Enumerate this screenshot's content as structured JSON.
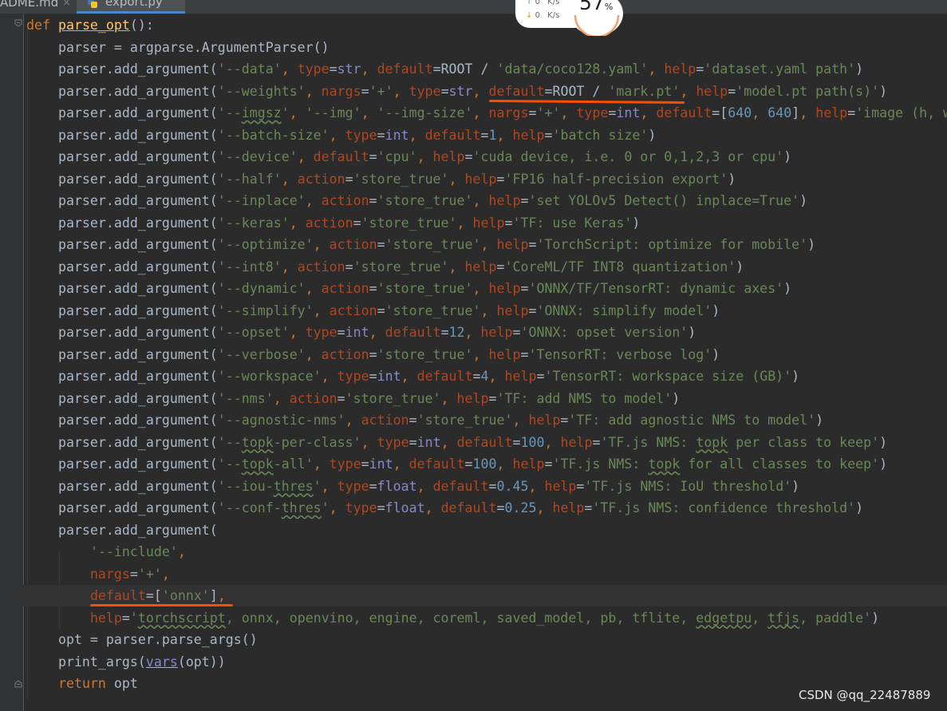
{
  "tabs": [
    {
      "label": "ADME.md",
      "close": "×"
    },
    {
      "label": "export.py"
    }
  ],
  "net_monitor": {
    "upload": "0",
    "download": "0",
    "unit": "K/s",
    "percent": "57",
    "percent_symbol": "%"
  },
  "watermark": "CSDN @qq_22487889",
  "colors": {
    "keyword": "#cc7832",
    "string": "#6a8759",
    "number": "#6897bb",
    "function": "#ffc66d",
    "param": "#aa4926",
    "annotation": "#ff4d00"
  },
  "code": [
    [
      [
        "kw",
        "def "
      ],
      [
        "fn",
        "parse_opt"
      ],
      [
        "tx",
        "():"
      ]
    ],
    [
      [
        "tx",
        "    parser = argparse.ArgumentParser()"
      ]
    ],
    [
      [
        "tx",
        "    parser.add_argument("
      ],
      [
        "str",
        "'--data'"
      ],
      [
        "kw",
        ", "
      ],
      [
        "pn",
        "type"
      ],
      [
        "tx",
        "="
      ],
      [
        "bi",
        "str"
      ],
      [
        "kw",
        ", "
      ],
      [
        "pn",
        "default"
      ],
      [
        "tx",
        "=ROOT / "
      ],
      [
        "str",
        "'data/coco128.yaml'"
      ],
      [
        "kw",
        ", "
      ],
      [
        "pn",
        "help"
      ],
      [
        "tx",
        "="
      ],
      [
        "str",
        "'dataset.yaml path'"
      ],
      [
        "tx",
        ")"
      ]
    ],
    [
      [
        "tx",
        "    parser.add_argument("
      ],
      [
        "str",
        "'--weights'"
      ],
      [
        "kw",
        ", "
      ],
      [
        "pn",
        "nargs"
      ],
      [
        "tx",
        "="
      ],
      [
        "str",
        "'+'"
      ],
      [
        "kw",
        ", "
      ],
      [
        "pn",
        "type"
      ],
      [
        "tx",
        "="
      ],
      [
        "bi",
        "str"
      ],
      [
        "kw",
        ", "
      ],
      [
        "pn",
        "default"
      ],
      [
        "tx",
        "=ROOT / "
      ],
      [
        "str",
        "'mark.pt'"
      ],
      [
        "kw",
        ", "
      ],
      [
        "pn",
        "help"
      ],
      [
        "tx",
        "="
      ],
      [
        "str",
        "'model.pt path(s)'"
      ],
      [
        "tx",
        ")"
      ]
    ],
    [
      [
        "tx",
        "    parser.add_argument("
      ],
      [
        "str",
        "'--"
      ],
      [
        "strw",
        "imgsz"
      ],
      [
        "str",
        "'"
      ],
      [
        "kw",
        ", "
      ],
      [
        "str",
        "'--img'"
      ],
      [
        "kw",
        ", "
      ],
      [
        "str",
        "'--img-size'"
      ],
      [
        "kw",
        ", "
      ],
      [
        "pn",
        "nargs"
      ],
      [
        "tx",
        "="
      ],
      [
        "str",
        "'+'"
      ],
      [
        "kw",
        ", "
      ],
      [
        "pn",
        "type"
      ],
      [
        "tx",
        "="
      ],
      [
        "bi",
        "int"
      ],
      [
        "kw",
        ", "
      ],
      [
        "pn",
        "default"
      ],
      [
        "tx",
        "=["
      ],
      [
        "num",
        "640"
      ],
      [
        "kw",
        ", "
      ],
      [
        "num",
        "640"
      ],
      [
        "tx",
        "]"
      ],
      [
        "kw",
        ", "
      ],
      [
        "pn",
        "help"
      ],
      [
        "tx",
        "="
      ],
      [
        "str",
        "'image (h, w)'"
      ],
      [
        "tx",
        ")"
      ]
    ],
    [
      [
        "tx",
        "    parser.add_argument("
      ],
      [
        "str",
        "'--batch-size'"
      ],
      [
        "kw",
        ", "
      ],
      [
        "pn",
        "type"
      ],
      [
        "tx",
        "="
      ],
      [
        "bi",
        "int"
      ],
      [
        "kw",
        ", "
      ],
      [
        "pn",
        "default"
      ],
      [
        "tx",
        "="
      ],
      [
        "num",
        "1"
      ],
      [
        "kw",
        ", "
      ],
      [
        "pn",
        "help"
      ],
      [
        "tx",
        "="
      ],
      [
        "str",
        "'batch size'"
      ],
      [
        "tx",
        ")"
      ]
    ],
    [
      [
        "tx",
        "    parser.add_argument("
      ],
      [
        "str",
        "'--device'"
      ],
      [
        "kw",
        ", "
      ],
      [
        "pn",
        "default"
      ],
      [
        "tx",
        "="
      ],
      [
        "str",
        "'cpu'"
      ],
      [
        "kw",
        ", "
      ],
      [
        "pn",
        "help"
      ],
      [
        "tx",
        "="
      ],
      [
        "str",
        "'cuda device, i.e. 0 or 0,1,2,3 or cpu'"
      ],
      [
        "tx",
        ")"
      ]
    ],
    [
      [
        "tx",
        "    parser.add_argument("
      ],
      [
        "str",
        "'--half'"
      ],
      [
        "kw",
        ", "
      ],
      [
        "pn",
        "action"
      ],
      [
        "tx",
        "="
      ],
      [
        "str",
        "'store_true'"
      ],
      [
        "kw",
        ", "
      ],
      [
        "pn",
        "help"
      ],
      [
        "tx",
        "="
      ],
      [
        "str",
        "'FP16 half-precision export'"
      ],
      [
        "tx",
        ")"
      ]
    ],
    [
      [
        "tx",
        "    parser.add_argument("
      ],
      [
        "str",
        "'--inplace'"
      ],
      [
        "kw",
        ", "
      ],
      [
        "pn",
        "action"
      ],
      [
        "tx",
        "="
      ],
      [
        "str",
        "'store_true'"
      ],
      [
        "kw",
        ", "
      ],
      [
        "pn",
        "help"
      ],
      [
        "tx",
        "="
      ],
      [
        "str",
        "'set YOLOv5 Detect() inplace=True'"
      ],
      [
        "tx",
        ")"
      ]
    ],
    [
      [
        "tx",
        "    parser.add_argument("
      ],
      [
        "str",
        "'--keras'"
      ],
      [
        "kw",
        ", "
      ],
      [
        "pn",
        "action"
      ],
      [
        "tx",
        "="
      ],
      [
        "str",
        "'store_true'"
      ],
      [
        "kw",
        ", "
      ],
      [
        "pn",
        "help"
      ],
      [
        "tx",
        "="
      ],
      [
        "str",
        "'TF: use Keras'"
      ],
      [
        "tx",
        ")"
      ]
    ],
    [
      [
        "tx",
        "    parser.add_argument("
      ],
      [
        "str",
        "'--optimize'"
      ],
      [
        "kw",
        ", "
      ],
      [
        "pn",
        "action"
      ],
      [
        "tx",
        "="
      ],
      [
        "str",
        "'store_true'"
      ],
      [
        "kw",
        ", "
      ],
      [
        "pn",
        "help"
      ],
      [
        "tx",
        "="
      ],
      [
        "str",
        "'TorchScript: optimize for mobile'"
      ],
      [
        "tx",
        ")"
      ]
    ],
    [
      [
        "tx",
        "    parser.add_argument("
      ],
      [
        "str",
        "'--int8'"
      ],
      [
        "kw",
        ", "
      ],
      [
        "pn",
        "action"
      ],
      [
        "tx",
        "="
      ],
      [
        "str",
        "'store_true'"
      ],
      [
        "kw",
        ", "
      ],
      [
        "pn",
        "help"
      ],
      [
        "tx",
        "="
      ],
      [
        "str",
        "'CoreML/TF INT8 quantization'"
      ],
      [
        "tx",
        ")"
      ]
    ],
    [
      [
        "tx",
        "    parser.add_argument("
      ],
      [
        "str",
        "'--dynamic'"
      ],
      [
        "kw",
        ", "
      ],
      [
        "pn",
        "action"
      ],
      [
        "tx",
        "="
      ],
      [
        "str",
        "'store_true'"
      ],
      [
        "kw",
        ", "
      ],
      [
        "pn",
        "help"
      ],
      [
        "tx",
        "="
      ],
      [
        "str",
        "'ONNX/TF/TensorRT: dynamic axes'"
      ],
      [
        "tx",
        ")"
      ]
    ],
    [
      [
        "tx",
        "    parser.add_argument("
      ],
      [
        "str",
        "'--simplify'"
      ],
      [
        "kw",
        ", "
      ],
      [
        "pn",
        "action"
      ],
      [
        "tx",
        "="
      ],
      [
        "str",
        "'store_true'"
      ],
      [
        "kw",
        ", "
      ],
      [
        "pn",
        "help"
      ],
      [
        "tx",
        "="
      ],
      [
        "str",
        "'ONNX: simplify model'"
      ],
      [
        "tx",
        ")"
      ]
    ],
    [
      [
        "tx",
        "    parser.add_argument("
      ],
      [
        "str",
        "'--opset'"
      ],
      [
        "kw",
        ", "
      ],
      [
        "pn",
        "type"
      ],
      [
        "tx",
        "="
      ],
      [
        "bi",
        "int"
      ],
      [
        "kw",
        ", "
      ],
      [
        "pn",
        "default"
      ],
      [
        "tx",
        "="
      ],
      [
        "num",
        "12"
      ],
      [
        "kw",
        ", "
      ],
      [
        "pn",
        "help"
      ],
      [
        "tx",
        "="
      ],
      [
        "str",
        "'ONNX: opset version'"
      ],
      [
        "tx",
        ")"
      ]
    ],
    [
      [
        "tx",
        "    parser.add_argument("
      ],
      [
        "str",
        "'--verbose'"
      ],
      [
        "kw",
        ", "
      ],
      [
        "pn",
        "action"
      ],
      [
        "tx",
        "="
      ],
      [
        "str",
        "'store_true'"
      ],
      [
        "kw",
        ", "
      ],
      [
        "pn",
        "help"
      ],
      [
        "tx",
        "="
      ],
      [
        "str",
        "'TensorRT: verbose log'"
      ],
      [
        "tx",
        ")"
      ]
    ],
    [
      [
        "tx",
        "    parser.add_argument("
      ],
      [
        "str",
        "'--workspace'"
      ],
      [
        "kw",
        ", "
      ],
      [
        "pn",
        "type"
      ],
      [
        "tx",
        "="
      ],
      [
        "bi",
        "int"
      ],
      [
        "kw",
        ", "
      ],
      [
        "pn",
        "default"
      ],
      [
        "tx",
        "="
      ],
      [
        "num",
        "4"
      ],
      [
        "kw",
        ", "
      ],
      [
        "pn",
        "help"
      ],
      [
        "tx",
        "="
      ],
      [
        "str",
        "'TensorRT: workspace size (GB)'"
      ],
      [
        "tx",
        ")"
      ]
    ],
    [
      [
        "tx",
        "    parser.add_argument("
      ],
      [
        "str",
        "'--nms'"
      ],
      [
        "kw",
        ", "
      ],
      [
        "pn",
        "action"
      ],
      [
        "tx",
        "="
      ],
      [
        "str",
        "'store_true'"
      ],
      [
        "kw",
        ", "
      ],
      [
        "pn",
        "help"
      ],
      [
        "tx",
        "="
      ],
      [
        "str",
        "'TF: add NMS to model'"
      ],
      [
        "tx",
        ")"
      ]
    ],
    [
      [
        "tx",
        "    parser.add_argument("
      ],
      [
        "str",
        "'--agnostic-nms'"
      ],
      [
        "kw",
        ", "
      ],
      [
        "pn",
        "action"
      ],
      [
        "tx",
        "="
      ],
      [
        "str",
        "'store_true'"
      ],
      [
        "kw",
        ", "
      ],
      [
        "pn",
        "help"
      ],
      [
        "tx",
        "="
      ],
      [
        "str",
        "'TF: add agnostic NMS to model'"
      ],
      [
        "tx",
        ")"
      ]
    ],
    [
      [
        "tx",
        "    parser.add_argument("
      ],
      [
        "str",
        "'--"
      ],
      [
        "strw",
        "topk"
      ],
      [
        "str",
        "-per-class'"
      ],
      [
        "kw",
        ", "
      ],
      [
        "pn",
        "type"
      ],
      [
        "tx",
        "="
      ],
      [
        "bi",
        "int"
      ],
      [
        "kw",
        ", "
      ],
      [
        "pn",
        "default"
      ],
      [
        "tx",
        "="
      ],
      [
        "num",
        "100"
      ],
      [
        "kw",
        ", "
      ],
      [
        "pn",
        "help"
      ],
      [
        "tx",
        "="
      ],
      [
        "str",
        "'TF.js NMS: "
      ],
      [
        "strw",
        "topk"
      ],
      [
        "str",
        " per class to keep'"
      ],
      [
        "tx",
        ")"
      ]
    ],
    [
      [
        "tx",
        "    parser.add_argument("
      ],
      [
        "str",
        "'--"
      ],
      [
        "strw",
        "topk"
      ],
      [
        "str",
        "-all'"
      ],
      [
        "kw",
        ", "
      ],
      [
        "pn",
        "type"
      ],
      [
        "tx",
        "="
      ],
      [
        "bi",
        "int"
      ],
      [
        "kw",
        ", "
      ],
      [
        "pn",
        "default"
      ],
      [
        "tx",
        "="
      ],
      [
        "num",
        "100"
      ],
      [
        "kw",
        ", "
      ],
      [
        "pn",
        "help"
      ],
      [
        "tx",
        "="
      ],
      [
        "str",
        "'TF.js NMS: "
      ],
      [
        "strw",
        "topk"
      ],
      [
        "str",
        " for all classes to keep'"
      ],
      [
        "tx",
        ")"
      ]
    ],
    [
      [
        "tx",
        "    parser.add_argument("
      ],
      [
        "str",
        "'--iou-"
      ],
      [
        "strw",
        "thres"
      ],
      [
        "str",
        "'"
      ],
      [
        "kw",
        ", "
      ],
      [
        "pn",
        "type"
      ],
      [
        "tx",
        "="
      ],
      [
        "bi",
        "float"
      ],
      [
        "kw",
        ", "
      ],
      [
        "pn",
        "default"
      ],
      [
        "tx",
        "="
      ],
      [
        "num",
        "0.45"
      ],
      [
        "kw",
        ", "
      ],
      [
        "pn",
        "help"
      ],
      [
        "tx",
        "="
      ],
      [
        "str",
        "'TF.js NMS: IoU threshold'"
      ],
      [
        "tx",
        ")"
      ]
    ],
    [
      [
        "tx",
        "    parser.add_argument("
      ],
      [
        "str",
        "'--conf-"
      ],
      [
        "strw",
        "thres"
      ],
      [
        "str",
        "'"
      ],
      [
        "kw",
        ", "
      ],
      [
        "pn",
        "type"
      ],
      [
        "tx",
        "="
      ],
      [
        "bi",
        "float"
      ],
      [
        "kw",
        ", "
      ],
      [
        "pn",
        "default"
      ],
      [
        "tx",
        "="
      ],
      [
        "num",
        "0.25"
      ],
      [
        "kw",
        ", "
      ],
      [
        "pn",
        "help"
      ],
      [
        "tx",
        "="
      ],
      [
        "str",
        "'TF.js NMS: confidence threshold'"
      ],
      [
        "tx",
        ")"
      ]
    ],
    [
      [
        "tx",
        "    parser.add_argument("
      ]
    ],
    [
      [
        "tx",
        "        "
      ],
      [
        "str",
        "'--include'"
      ],
      [
        "kw",
        ","
      ]
    ],
    [
      [
        "tx",
        "        "
      ],
      [
        "pn",
        "nargs"
      ],
      [
        "tx",
        "="
      ],
      [
        "str",
        "'+'"
      ],
      [
        "kw",
        ","
      ]
    ],
    [
      [
        "tx",
        "        "
      ],
      [
        "pn",
        "default"
      ],
      [
        "tx",
        "=["
      ],
      [
        "str",
        "'onnx'"
      ],
      [
        "tx",
        "]"
      ],
      [
        "kw",
        ","
      ]
    ],
    [
      [
        "tx",
        "        "
      ],
      [
        "pn",
        "help"
      ],
      [
        "tx",
        "="
      ],
      [
        "str",
        "'"
      ],
      [
        "strw",
        "torchscript"
      ],
      [
        "str",
        ", onnx, openvino, engine, coreml, saved_model, pb, tflite, "
      ],
      [
        "strw",
        "edgetpu"
      ],
      [
        "str",
        ", "
      ],
      [
        "strw",
        "tfjs"
      ],
      [
        "str",
        ", paddle'"
      ],
      [
        "tx",
        ")"
      ]
    ],
    [
      [
        "tx",
        "    opt = parser.parse_args()"
      ]
    ],
    [
      [
        "tx",
        "    print_args("
      ],
      [
        "bi",
        "vars"
      ],
      [
        "tx",
        "(opt))"
      ]
    ],
    [
      [
        "tx",
        "    "
      ],
      [
        "kw",
        "return "
      ],
      [
        "tx",
        "opt"
      ]
    ]
  ]
}
